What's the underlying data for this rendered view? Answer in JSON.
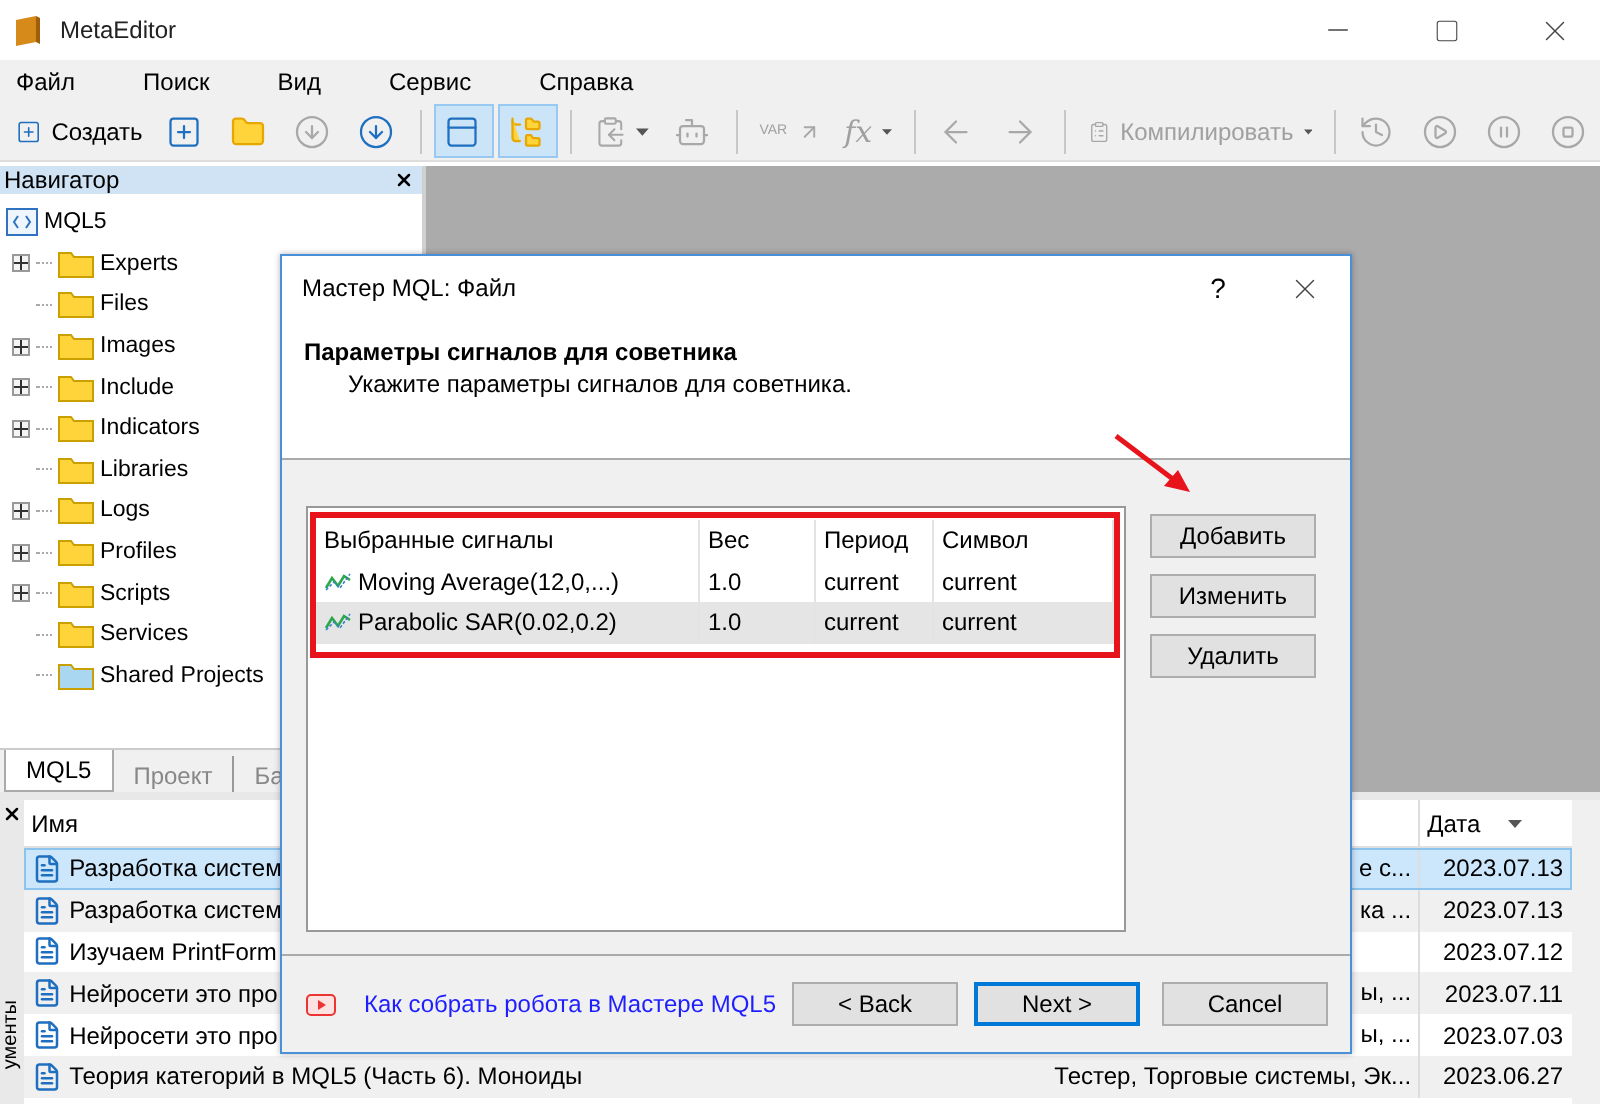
{
  "app": {
    "title": "MetaEditor"
  },
  "menu": [
    "Файл",
    "Поиск",
    "Вид",
    "Сервис",
    "Справка"
  ],
  "toolbar": [
    {
      "kind": "create",
      "label": "Создать",
      "disabled": false,
      "pressed": false
    },
    {
      "kind": "new",
      "disabled": false,
      "pressed": false
    },
    {
      "kind": "open",
      "disabled": false,
      "pressed": false
    },
    {
      "kind": "download",
      "disabled": true,
      "pressed": false
    },
    {
      "kind": "install",
      "disabled": false,
      "pressed": false
    },
    {
      "kind": "separator"
    },
    {
      "kind": "layout",
      "disabled": false,
      "pressed": true
    },
    {
      "kind": "navigator",
      "disabled": false,
      "pressed": true
    },
    {
      "kind": "separator"
    },
    {
      "kind": "clipboard",
      "disabled": true,
      "pressed": false
    },
    {
      "kind": "robot",
      "disabled": true,
      "pressed": false
    },
    {
      "kind": "separator"
    },
    {
      "kind": "variable",
      "label": "VAR",
      "disabled": true,
      "pressed": false
    },
    {
      "kind": "function",
      "label": "fx",
      "disabled": true,
      "pressed": false
    },
    {
      "kind": "separator"
    },
    {
      "kind": "back",
      "disabled": true,
      "pressed": false
    },
    {
      "kind": "forward",
      "disabled": true,
      "pressed": false
    },
    {
      "kind": "separator"
    },
    {
      "kind": "compile",
      "label": "Компилировать",
      "disabled": true,
      "pressed": false
    },
    {
      "kind": "separator"
    },
    {
      "kind": "history",
      "disabled": true,
      "pressed": false
    },
    {
      "kind": "play",
      "disabled": true,
      "pressed": false
    },
    {
      "kind": "pause",
      "disabled": true,
      "pressed": false
    },
    {
      "kind": "stop",
      "disabled": true,
      "pressed": false
    }
  ],
  "navigator": {
    "title": "Навигатор",
    "root": "MQL5",
    "items": [
      {
        "label": "Experts",
        "has_children": true,
        "color": "#ffd43b"
      },
      {
        "label": "Files",
        "has_children": false,
        "color": "#ffd43b"
      },
      {
        "label": "Images",
        "has_children": true,
        "color": "#ffd43b"
      },
      {
        "label": "Include",
        "has_children": true,
        "color": "#ffd43b"
      },
      {
        "label": "Indicators",
        "has_children": true,
        "color": "#ffd43b"
      },
      {
        "label": "Libraries",
        "has_children": false,
        "color": "#ffd43b"
      },
      {
        "label": "Logs",
        "has_children": true,
        "color": "#ffd43b"
      },
      {
        "label": "Profiles",
        "has_children": true,
        "color": "#ffd43b"
      },
      {
        "label": "Scripts",
        "has_children": true,
        "color": "#ffd43b"
      },
      {
        "label": "Services",
        "has_children": false,
        "color": "#ffd43b"
      },
      {
        "label": "Shared Projects",
        "has_children": false,
        "color": "#a9d7f2"
      }
    ],
    "tabs": [
      {
        "label": "MQL5",
        "selected": true
      },
      {
        "label": "Проект",
        "selected": false
      },
      {
        "label": "Ба",
        "selected": false
      }
    ]
  },
  "bottom_panel": {
    "side_label": "ументы",
    "columns": {
      "name": "Имя",
      "date": "Дата"
    },
    "rows": [
      {
        "name": "Разработка систем",
        "column_2": "е с...",
        "date": "2023.07.13",
        "selected": true
      },
      {
        "name": "Разработка систем",
        "column_2": "ка ...",
        "date": "2023.07.13",
        "selected": false
      },
      {
        "name": "Изучаем PrintForm",
        "date": "2023.07.12",
        "selected": false
      },
      {
        "name": "Нейросети  это про",
        "column_2": "ы, ...",
        "date": "2023.07.11",
        "selected": false
      },
      {
        "name": "Нейросети  это про",
        "column_2": "ы, ...",
        "date": "2023.07.03",
        "selected": false
      },
      {
        "name": "Теория категорий в MQL5 (Часть 6). Моноиды",
        "column_2": "Тестер, Торговые системы, Эк...",
        "date": "2023.06.27",
        "selected": false
      }
    ]
  },
  "dialog": {
    "title": "Мастер MQL: Файл",
    "help": "?",
    "heading": "Параметры сигналов для советника",
    "subheading": "Укажите параметры сигналов для советника.",
    "columns": [
      "Выбранные сигналы",
      "Вес",
      "Период",
      "Символ"
    ],
    "signals": [
      {
        "name": "Moving Average(12,0,...)",
        "weight": "1.0",
        "period": "current",
        "symbol": "current",
        "selected": false
      },
      {
        "name": "Parabolic SAR(0.02,0.2)",
        "weight": "1.0",
        "period": "current",
        "symbol": "current",
        "selected": true
      }
    ],
    "side_buttons": [
      "Добавить",
      "Изменить",
      "Удалить"
    ],
    "link": "Как собрать робота в Мастере MQL5",
    "buttons": [
      {
        "label": "< Back",
        "default": false
      },
      {
        "label": "Next >",
        "default": true
      },
      {
        "label": "Cancel",
        "default": false
      }
    ]
  }
}
